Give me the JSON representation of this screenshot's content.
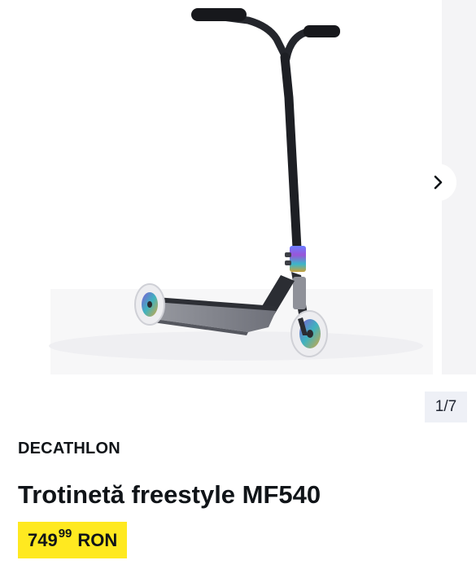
{
  "gallery": {
    "counter": "1/7",
    "next_icon": "chevron-right-icon",
    "image": "scooter-photo"
  },
  "product": {
    "brand": "DECATHLON",
    "title": "Trotinetă freestyle MF540",
    "price": {
      "integer": "749",
      "decimals": "99",
      "currency": "RON"
    }
  },
  "colors": {
    "price_badge": "#ffe920",
    "counter_bg": "#eef0f6",
    "text": "#101418"
  }
}
